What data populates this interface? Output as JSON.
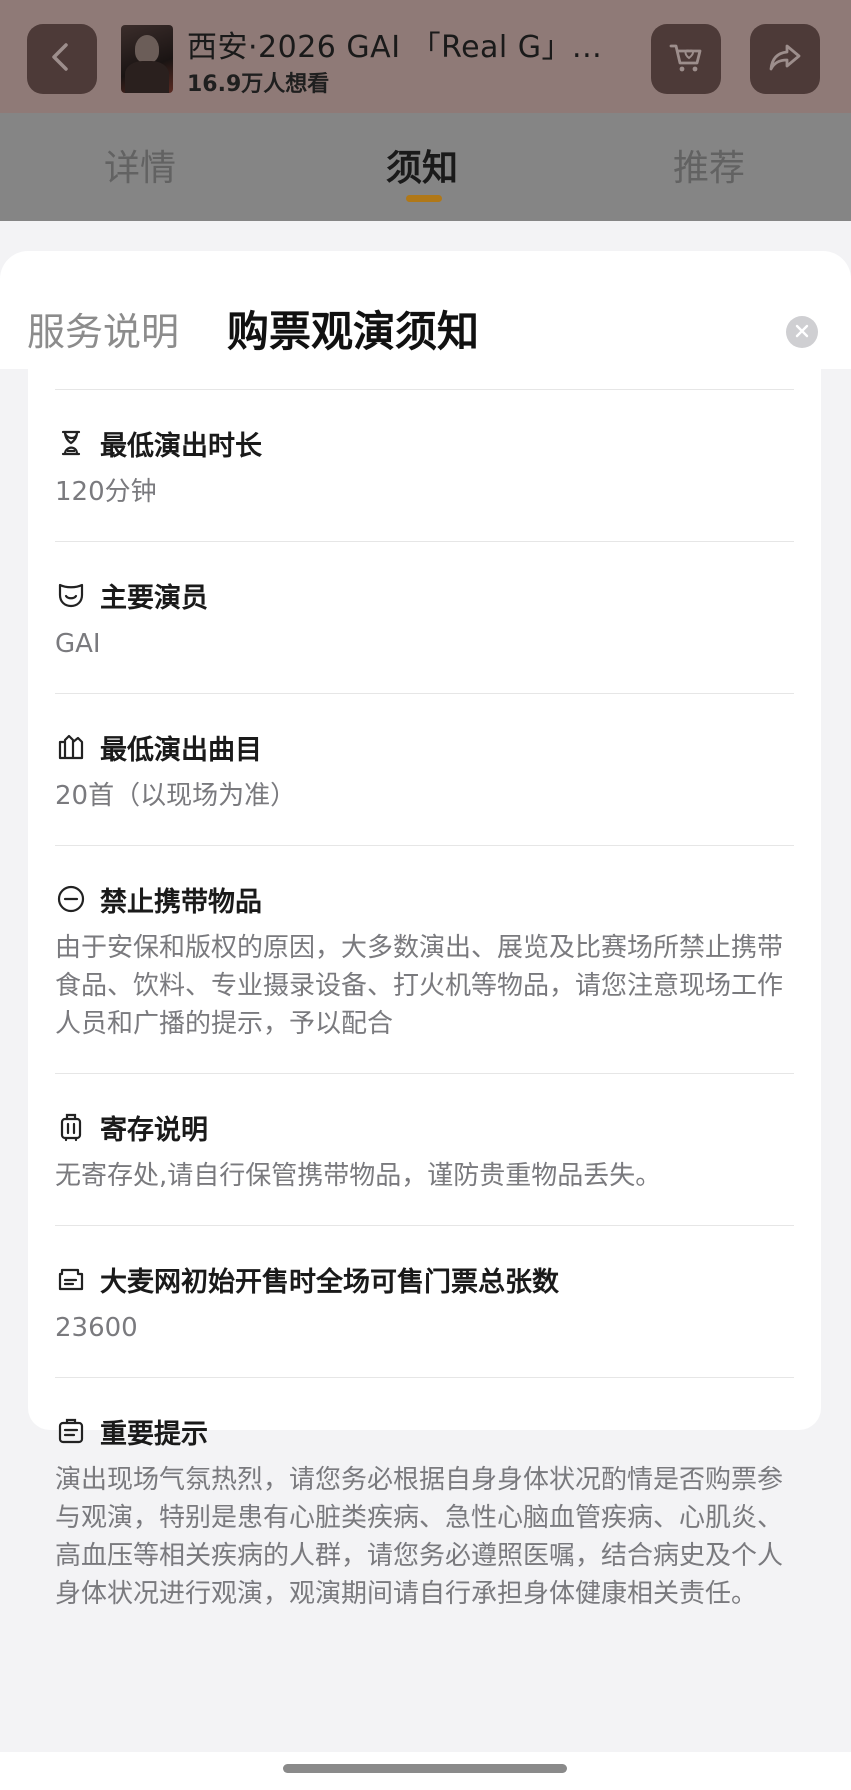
{
  "header": {
    "event_title": "西安·2026 GAI 「Real G」...",
    "want_count": "16.9万人想看",
    "back_icon": "chevron-left-icon",
    "cart_icon": "cart-heart-icon",
    "share_icon": "share-arrow-icon"
  },
  "tabs": [
    {
      "label": "详情"
    },
    {
      "label": "须知"
    },
    {
      "label": "推荐"
    }
  ],
  "sheet": {
    "tab_service": "服务说明",
    "tab_notice": "购票观演须知",
    "close_icon": "close-icon"
  },
  "sections": [
    {
      "icon": "hourglass-icon",
      "title": "最低演出时长",
      "body": "120分钟"
    },
    {
      "icon": "mask-icon",
      "title": "主要演员",
      "body": "GAI"
    },
    {
      "icon": "music-book-icon",
      "title": "最低演出曲目",
      "body": "20首（以现场为准）"
    },
    {
      "icon": "no-entry-icon",
      "title": "禁止携带物品",
      "body": "由于安保和版权的原因，大多数演出、展览及比赛场所禁止携带食品、饮料、专业摄录设备、打火机等物品，请您注意现场工作人员和广播的提示，予以配合"
    },
    {
      "icon": "luggage-icon",
      "title": "寄存说明",
      "body": "无寄存处,请自行保管携带物品，谨防贵重物品丢失。"
    },
    {
      "icon": "ticket-icon",
      "title": "大麦网初始开售时全场可售门票总张数",
      "body": "23600"
    },
    {
      "icon": "clipboard-icon",
      "title": "重要提示",
      "body": "演出现场气氛热烈，请您务必根据自身身体状况酌情是否购票参与观演，特别是患有心脏类疾病、急性心脑血管疾病、心肌炎、高血压等相关疾病的人群，请您务必遵照医嘱，结合病史及个人身体状况进行观演，观演期间请自行承担身体健康相关责任。"
    }
  ],
  "colors": {
    "accent": "#b07818",
    "text_primary": "#1a1a1a",
    "text_secondary": "#7a7a7e"
  }
}
